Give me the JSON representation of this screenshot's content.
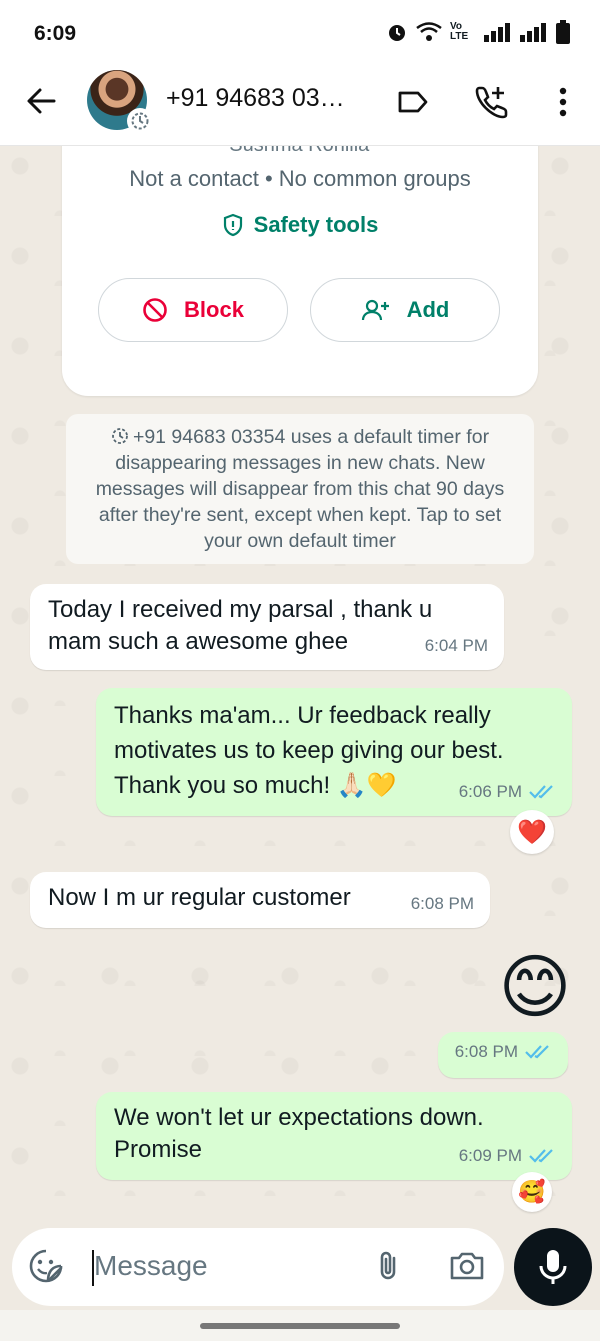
{
  "status_bar": {
    "time": "6:09",
    "volte_label": "Vo LTE"
  },
  "header": {
    "title": "+91 94683 03…",
    "colors": {
      "icon": "#111b21"
    }
  },
  "contact_card": {
    "name_cut": "~ Sushma Rohilla",
    "subtitle": "Not a contact • No common groups",
    "safety_label": "Safety tools",
    "block_label": "Block",
    "add_label": "Add",
    "colors": {
      "safety": "#008069",
      "block": "#ea0038"
    }
  },
  "system_note": "+91 94683 03354 uses a default timer for disappearing messages in new chats. New messages will disappear from this chat 90 days after they're sent, except when kept. Tap to set your own default timer",
  "messages": [
    {
      "dir": "in",
      "text": "Today I received my parsal , thank u mam such a awesome ghee",
      "time": "6:04 PM"
    },
    {
      "dir": "out",
      "text": "Thanks ma'am... Ur feedback really motivates us to keep giving our best. Thank you so much! 🙏🏻💛",
      "time": "6:06 PM",
      "reaction": "❤️"
    },
    {
      "dir": "in",
      "text": "Now I m ur regular customer",
      "time": "6:08 PM"
    },
    {
      "dir": "out",
      "text": "😊",
      "time": "6:08 PM"
    },
    {
      "dir": "out",
      "text": "We won't let ur expectations down. Promise",
      "time": "6:09 PM",
      "reaction": "🥰"
    }
  ],
  "composer": {
    "placeholder": "Message"
  },
  "icons": [
    "back-arrow-icon",
    "label-icon",
    "add-call-icon",
    "more-vert-icon",
    "emoji-sticker-icon",
    "attach-icon",
    "camera-icon",
    "mic-icon",
    "double-check-icon",
    "shield-icon",
    "block-icon",
    "add-person-icon",
    "timer-icon"
  ]
}
